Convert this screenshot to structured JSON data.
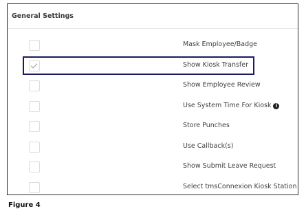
{
  "panel": {
    "title": "General Settings"
  },
  "settings": [
    {
      "label": "Mask Employee/Badge",
      "checked": false
    },
    {
      "label": "Show Kiosk Transfer",
      "checked": true
    },
    {
      "label": "Show Employee Review",
      "checked": false
    },
    {
      "label": "Use System Time For Kiosk",
      "checked": false,
      "info_icon": "info-icon"
    },
    {
      "label": "Store Punches",
      "checked": false
    },
    {
      "label": "Use Callback(s)",
      "checked": false
    },
    {
      "label": "Show Submit Leave Request",
      "checked": false
    },
    {
      "label": "Select tmsConnexion Kiosk Station",
      "checked": false
    }
  ],
  "info_glyph": "i",
  "caption": "Figure 4",
  "colors": {
    "highlight_border": "#1a1a5e",
    "panel_border": "#2a2a2a",
    "checkbox_border": "#dcdcdc"
  }
}
